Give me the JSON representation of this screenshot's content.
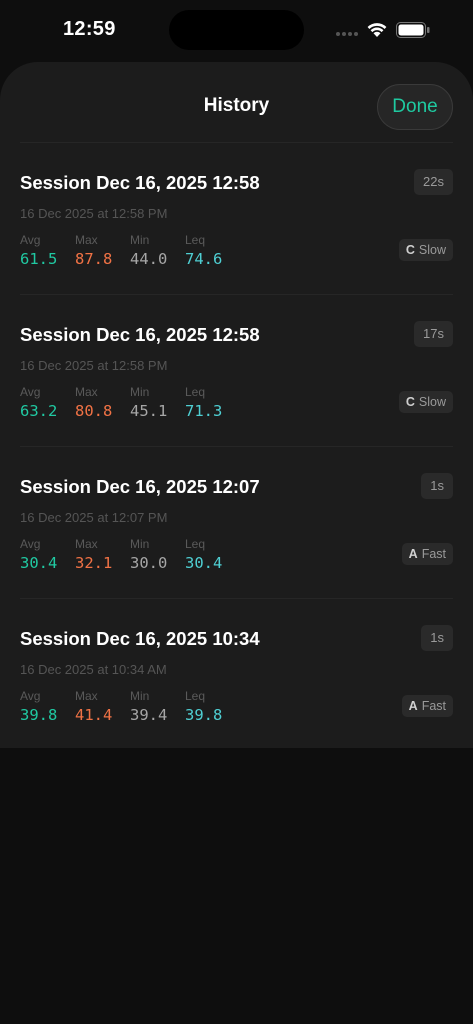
{
  "status_bar": {
    "time": "12:59"
  },
  "header": {
    "title": "History",
    "done_label": "Done"
  },
  "metric_labels": {
    "avg": "Avg",
    "max": "Max",
    "min": "Min",
    "leq": "Leq"
  },
  "colors": {
    "accent": "#1fc9a0",
    "avg": "#20c9a2",
    "max": "#f07245",
    "min": "#a6a6a6",
    "leq": "#4fcfd3"
  },
  "sessions": [
    {
      "title": "Session Dec 16, 2025 12:58",
      "date": "16 Dec 2025 at 12:58 PM",
      "duration": "22s",
      "avg": "61.5",
      "max": "87.8",
      "min": "44.0",
      "leq": "74.6",
      "weighting": "C",
      "response": "Slow"
    },
    {
      "title": "Session Dec 16, 2025 12:58",
      "date": "16 Dec 2025 at 12:58 PM",
      "duration": "17s",
      "avg": "63.2",
      "max": "80.8",
      "min": "45.1",
      "leq": "71.3",
      "weighting": "C",
      "response": "Slow"
    },
    {
      "title": "Session Dec 16, 2025 12:07",
      "date": "16 Dec 2025 at 12:07 PM",
      "duration": "1s",
      "avg": "30.4",
      "max": "32.1",
      "min": "30.0",
      "leq": "30.4",
      "weighting": "A",
      "response": "Fast"
    },
    {
      "title": "Session Dec 16, 2025 10:34",
      "date": "16 Dec 2025 at 10:34 AM",
      "duration": "1s",
      "avg": "39.8",
      "max": "41.4",
      "min": "39.4",
      "leq": "39.8",
      "weighting": "A",
      "response": "Fast"
    }
  ]
}
